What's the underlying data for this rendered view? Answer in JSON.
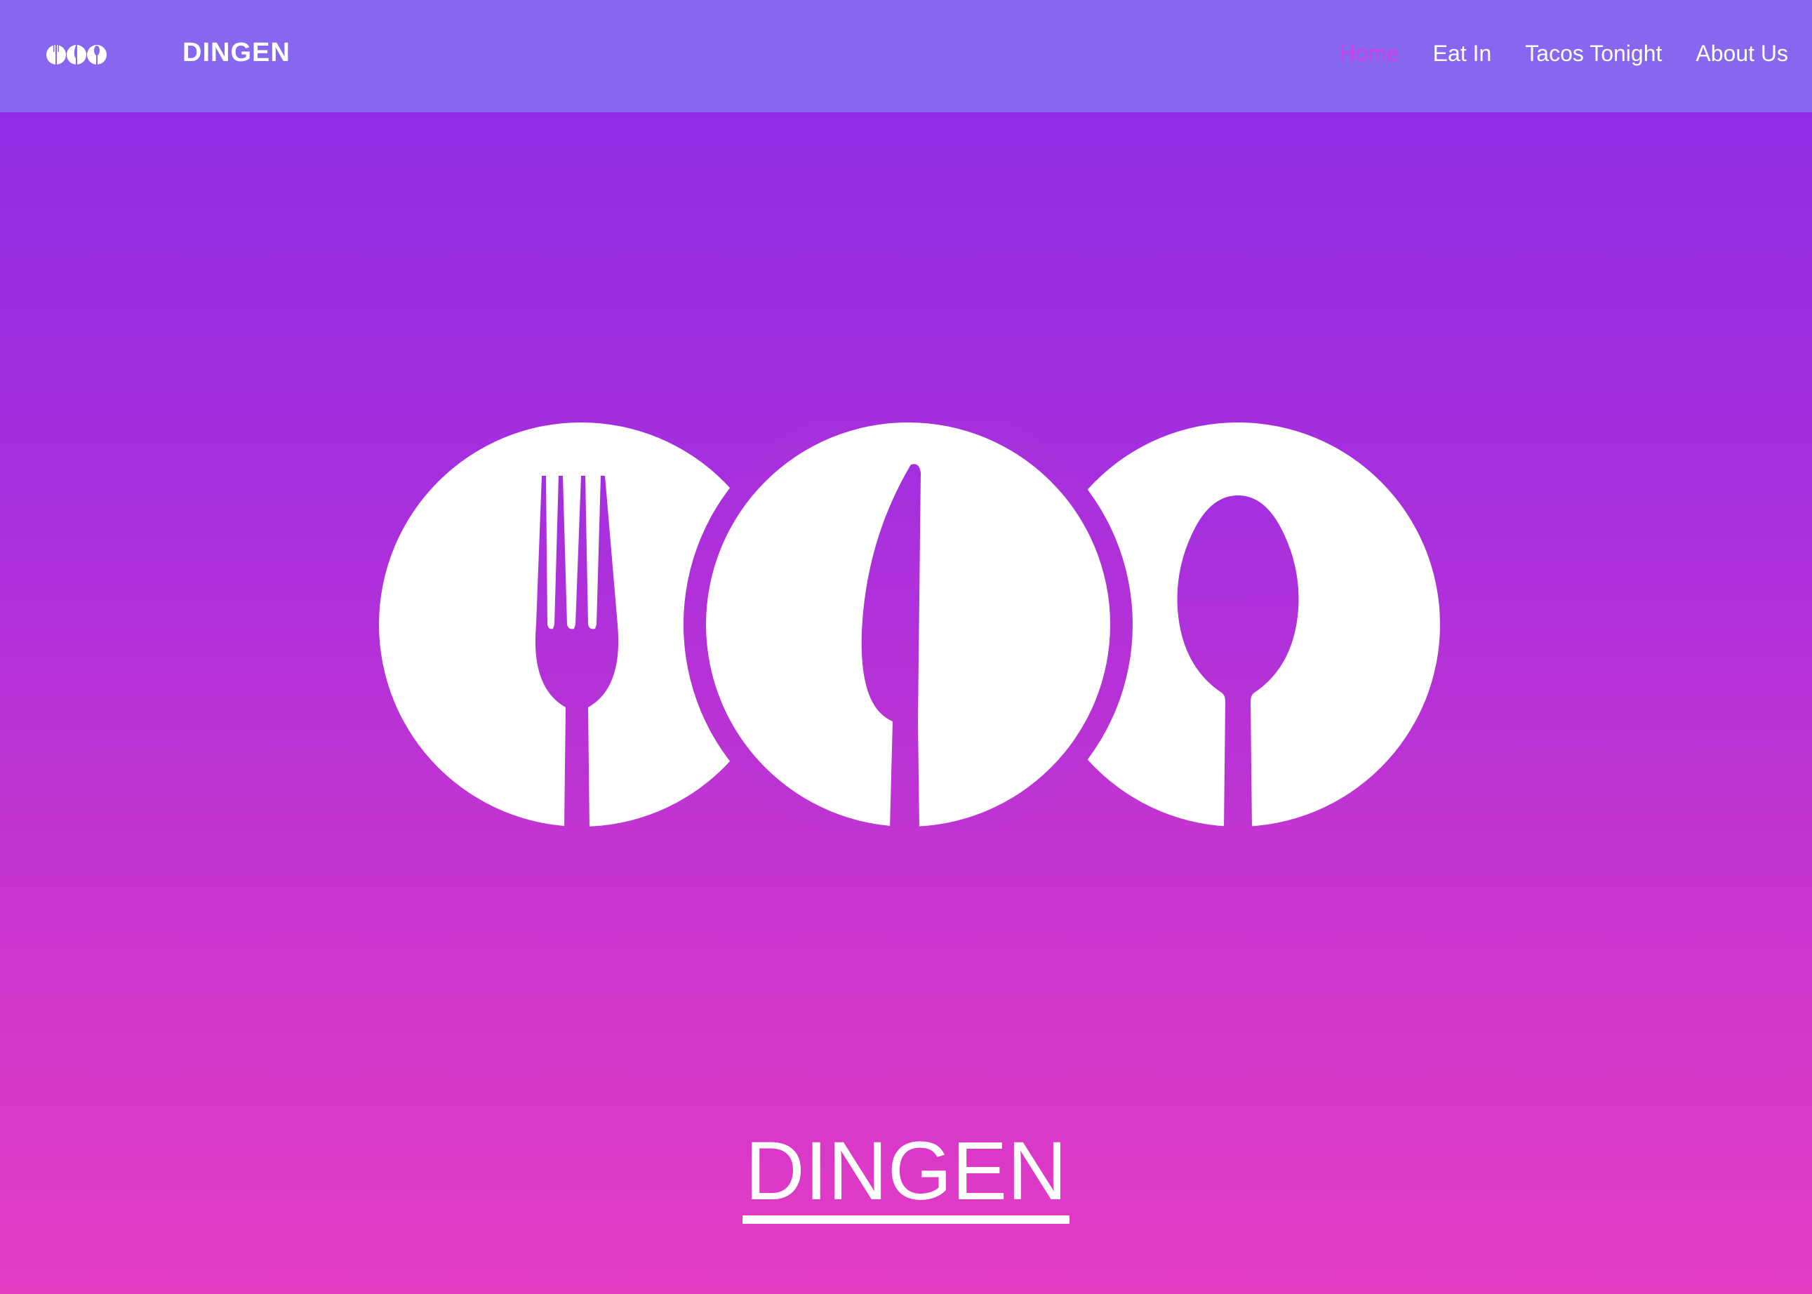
{
  "navbar": {
    "brand": "DINGEN",
    "logo_icon": "fork-knife-spoon-icon",
    "links": [
      {
        "label": "Home",
        "active": true
      },
      {
        "label": "Eat In",
        "active": false
      },
      {
        "label": "Tacos Tonight",
        "active": false
      },
      {
        "label": "About Us",
        "active": false
      }
    ]
  },
  "hero": {
    "logo_icon": "fork-knife-spoon-plates-icon",
    "title": "DINGEN"
  },
  "colors": {
    "navbar_bg": "#8767ee",
    "gradient_top": "#8a2be9",
    "gradient_bottom": "#e43bc3",
    "active_link": "#d13ee8",
    "text": "#ffffff"
  }
}
